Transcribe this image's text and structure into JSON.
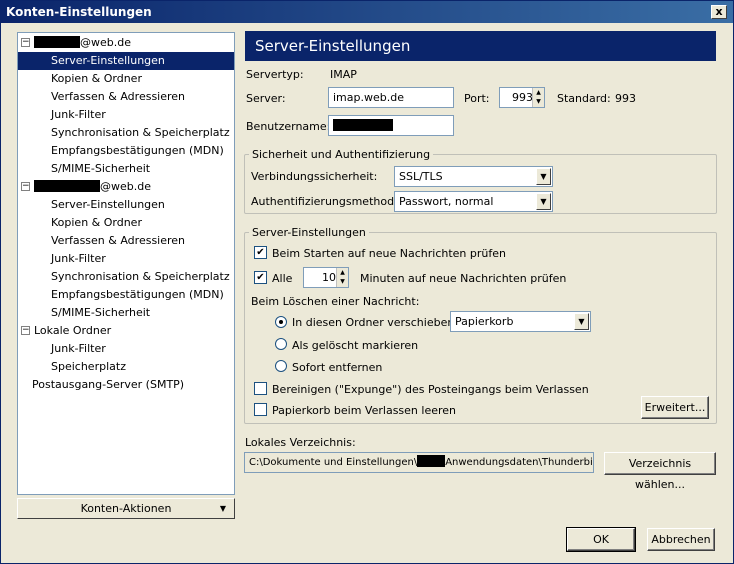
{
  "window": {
    "title": "Konten-Einstellungen",
    "close_glyph": "x"
  },
  "tree": {
    "account1": {
      "suffix": "@web.de"
    },
    "account1_items": [
      "Server-Einstellungen",
      "Kopien & Ordner",
      "Verfassen & Adressieren",
      "Junk-Filter",
      "Synchronisation & Speicherplatz",
      "Empfangsbestätigungen (MDN)",
      "S/MIME-Sicherheit"
    ],
    "account2": {
      "suffix": "@web.de"
    },
    "account2_items": [
      "Server-Einstellungen",
      "Kopien & Ordner",
      "Verfassen & Adressieren",
      "Junk-Filter",
      "Synchronisation & Speicherplatz",
      "Empfangsbestätigungen (MDN)",
      "S/MIME-Sicherheit"
    ],
    "local": {
      "label": "Lokale Ordner"
    },
    "local_items": [
      "Junk-Filter",
      "Speicherplatz"
    ],
    "smtp": {
      "label": "Postausgang-Server (SMTP)"
    },
    "expander_glyph": "−"
  },
  "konten_aktionen": {
    "label": "Konten-Aktionen",
    "arrow": "▼"
  },
  "page": {
    "title": "Server-Einstellungen"
  },
  "server": {
    "type_label": "Servertyp:",
    "type_value": "IMAP",
    "server_label": "Server:",
    "server_value": "imap.web.de",
    "port_label": "Port:",
    "port_value": "993",
    "standard_label": "Standard:",
    "standard_value": "993",
    "user_label": "Benutzername:"
  },
  "security": {
    "legend": "Sicherheit und Authentifizierung",
    "connection_label": "Verbindungssicherheit:",
    "connection_value": "SSL/TLS",
    "auth_label": "Authentifizierungsmethode:",
    "auth_value": "Passwort, normal"
  },
  "settings": {
    "legend": "Server-Einstellungen",
    "check_startup_label": "Beim Starten auf neue Nachrichten prüfen",
    "check_startup": true,
    "check_every_label": "Alle",
    "check_every": true,
    "minutes_value": "10",
    "minutes_label": "Minuten auf neue Nachrichten prüfen",
    "on_delete_label": "Beim Löschen einer Nachricht:",
    "move_label": "In diesen Ordner verschieben:",
    "move_folder": "Papierkorb",
    "mark_label": "Als gelöscht markieren",
    "remove_label": "Sofort entfernen",
    "expunge_label": "Bereinigen (\"Expunge\") des Posteingangs beim Verlassen",
    "expunge": false,
    "empty_trash_label": "Papierkorb beim Verlassen leeren",
    "empty_trash": false,
    "advanced_button": "Erweitert..."
  },
  "local_dir": {
    "label": "Lokales Verzeichnis:",
    "value_prefix": "C:\\Dokumente und Einstellungen\\",
    "value_suffix": "Anwendungsdaten\\Thunderbird\\",
    "choose_button": "Verzeichnis wählen..."
  },
  "footer": {
    "ok": "OK",
    "cancel": "Abbrechen"
  },
  "icons": {
    "check": "✔",
    "spin_up": "▲",
    "spin_down": "▼",
    "dropdown": "▼"
  }
}
